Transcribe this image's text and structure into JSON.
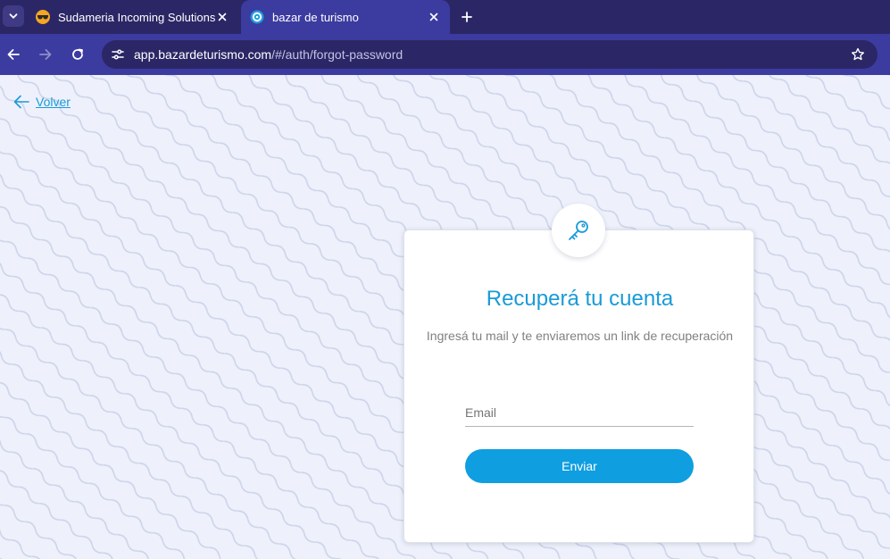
{
  "browser": {
    "tabs": [
      {
        "title": "Sudameria Incoming Solutions",
        "active": false,
        "favicon": "sunglasses-favicon"
      },
      {
        "title": "bazar de turismo",
        "active": true,
        "favicon": "bazar-favicon"
      }
    ],
    "url": {
      "host": "app.bazardeturismo.com",
      "path": "/#/auth/forgot-password"
    },
    "colors": {
      "tabbar": "#2b2766",
      "toolbar": "#3c3ba0",
      "omnibox": "#2b2766"
    }
  },
  "page": {
    "back_label": "Volver",
    "card": {
      "title": "Recuperá tu cuenta",
      "subtitle": "Ingresá tu mail y te enviaremos un link de recuperación",
      "email_placeholder": "Email",
      "email_value": "",
      "submit_label": "Enviar"
    },
    "colors": {
      "accent": "#1a9bd7",
      "button": "#0f9ee0",
      "background": "#eef1fb",
      "pattern": "#cdd4ea"
    }
  }
}
